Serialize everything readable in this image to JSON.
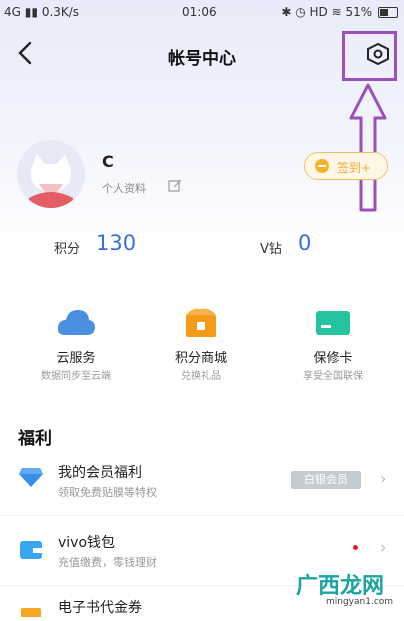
{
  "status_bar": {
    "network": "4G",
    "speed": "0.3K/s",
    "time": "01:06",
    "hd": "HD",
    "battery": "51%"
  },
  "header": {
    "title": "帐号中心"
  },
  "profile": {
    "name": "C",
    "subtitle": "个人资料",
    "signin_label": "签到+"
  },
  "points": {
    "jifen_label": "积分",
    "jifen_value": "130",
    "vzuan_label": "V钻",
    "vzuan_value": "0"
  },
  "services": [
    {
      "label": "云服务",
      "sub": "数据同步至云端",
      "icon": "cloud-icon",
      "color": "#4a90e2"
    },
    {
      "label": "积分商城",
      "sub": "兑换礼品",
      "icon": "shop-icon",
      "color": "#f59a1b"
    },
    {
      "label": "保修卡",
      "sub": "享受全国联保",
      "icon": "card-icon",
      "color": "#25c2a0"
    }
  ],
  "welfare": {
    "section_title": "福利",
    "items": [
      {
        "title": "我的会员福利",
        "sub": "领取免费贴膜等特权",
        "badge": "白银会员",
        "icon": "diamond-icon"
      },
      {
        "title": "vivo钱包",
        "sub": "充值缴费，零钱理财",
        "icon": "wallet-icon"
      },
      {
        "title": "电子书代金券",
        "icon": "ebook-icon"
      }
    ]
  },
  "watermark": {
    "cn": "广西龙网",
    "en": "mingyan1.com"
  }
}
